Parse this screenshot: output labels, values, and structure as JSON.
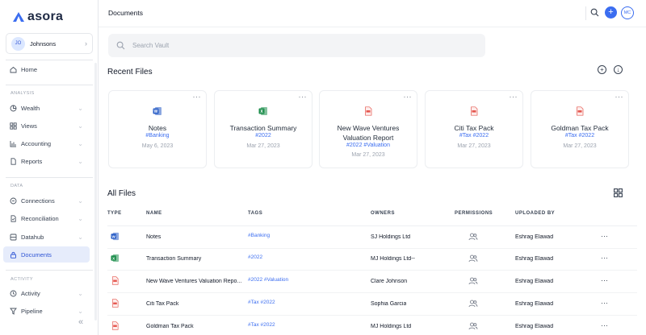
{
  "brand": {
    "name": "asora",
    "color": "#3b6df0"
  },
  "account": {
    "initials": "JO",
    "name": "Johnsons"
  },
  "nav": {
    "home": "Home",
    "analysis_label": "ANALYSIS",
    "analysis": [
      "Wealth",
      "Views",
      "Accounting",
      "Reports"
    ],
    "data_label": "DATA",
    "data": [
      "Connections",
      "Reconciliation",
      "Datahub",
      "Documents"
    ],
    "activity_label": "ACTIVITY",
    "activity": [
      "Activity",
      "Pipeline"
    ],
    "active": "Documents"
  },
  "header": {
    "title": "Documents",
    "user_initials": "MC",
    "add_label": "+"
  },
  "search": {
    "placeholder": "Search Vault",
    "value": ""
  },
  "recent": {
    "title": "Recent Files",
    "cards": [
      {
        "name": "Notes",
        "tags": "#Banking",
        "date": "May 6, 2023",
        "icon": "word-icon"
      },
      {
        "name": "Transaction Summary",
        "tags": "#2022",
        "date": "Mar 27, 2023",
        "icon": "excel-icon"
      },
      {
        "name": "New Wave Ventures Valuation Report",
        "tags": "#2022 #Valuation",
        "date": "Mar 27, 2023",
        "icon": "pdf-icon"
      },
      {
        "name": "Citi Tax Pack",
        "tags": "#Tax #2022",
        "date": "Mar 27, 2023",
        "icon": "pdf-icon"
      },
      {
        "name": "Goldman Tax Pack",
        "tags": "#Tax #2022",
        "date": "Mar 27, 2023",
        "icon": "pdf-icon"
      }
    ]
  },
  "all_files": {
    "title": "All Files",
    "columns": [
      "TYPE",
      "NAME",
      "TAGS",
      "OWNERS",
      "PERMISSIONS",
      "UPLOADED BY"
    ],
    "rows": [
      {
        "icon": "word-icon",
        "name": "Notes",
        "tags": "#Banking",
        "owners": "SJ Holdings Ltd",
        "uploaded_by": "Eshrag Elawad"
      },
      {
        "icon": "excel-icon",
        "name": "Transaction Summary",
        "tags": "#2022",
        "owners": "MJ Holdings Ltd--",
        "uploaded_by": "Eshrag Elawad"
      },
      {
        "icon": "pdf-icon",
        "name": "New Wave Ventures Valuation Repo...",
        "tags": "#2022 #Valuation",
        "owners": "Clare Johnson",
        "uploaded_by": "Eshrag Elawad"
      },
      {
        "icon": "pdf-icon",
        "name": "Citi Tax Pack",
        "tags": "#Tax #2022",
        "owners": "Sophia Garcia",
        "uploaded_by": "Eshrag Elawad"
      },
      {
        "icon": "pdf-icon",
        "name": "Goldman Tax Pack",
        "tags": "#Tax #2022",
        "owners": "MJ Holdings Ltd",
        "uploaded_by": "Eshrag Elawad"
      }
    ]
  },
  "menu_dots": "···",
  "colors": {
    "accent": "#3b6df0",
    "word": "#2b5fc7",
    "excel": "#1f8f4e",
    "pdf": "#e5574f"
  }
}
